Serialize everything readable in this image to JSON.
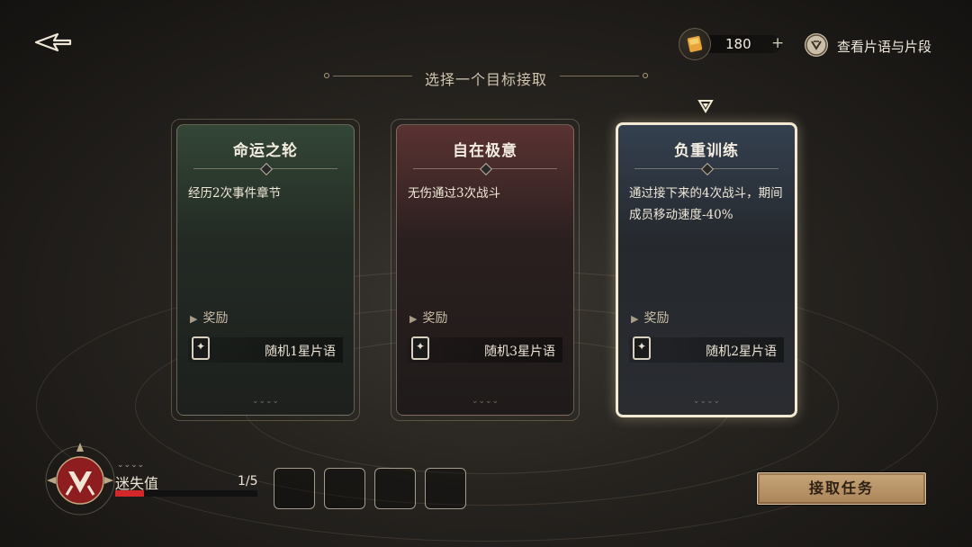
{
  "header": {
    "title": "选择一个目标接取",
    "currency_amount": "180",
    "currency_plus": "+",
    "view_link": "查看片语与片段"
  },
  "cards": [
    {
      "name": "命运之轮",
      "desc": "经历2次事件章节",
      "reward_label": "奖励",
      "reward_item": "随机1星片语",
      "theme": "green",
      "selected": false
    },
    {
      "name": "自在极意",
      "desc": "无伤通过3次战斗",
      "reward_label": "奖励",
      "reward_item": "随机3星片语",
      "theme": "red",
      "selected": false
    },
    {
      "name": "负重训练",
      "desc": "通过接下来的4次战斗，期间成员移动速度-40%",
      "reward_label": "奖励",
      "reward_item": "随机2星片语",
      "theme": "blue",
      "selected": true
    }
  ],
  "status": {
    "loss_label": "迷失值",
    "loss_count": "1/5",
    "loss_fraction": 0.2
  },
  "actions": {
    "accept": "接取任务"
  },
  "colors": {
    "accent_gold": "#c7a679",
    "loss_red": "#d2282c",
    "card_green": "#334636",
    "card_red": "#5a3232",
    "card_blue": "#34404f",
    "selected_border": "#f3e9d2"
  },
  "icons": [
    "back-arrow-icon",
    "currency-coin-icon",
    "phrase-book-icon",
    "selected-marker-icon",
    "card-reward-icon",
    "crimson-emblem-icon"
  ]
}
